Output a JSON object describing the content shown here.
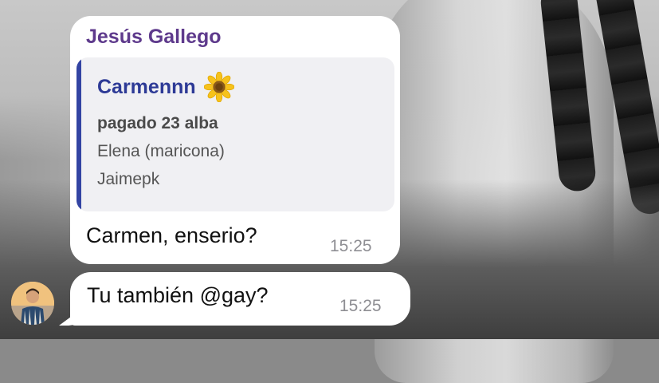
{
  "chat": {
    "messages": [
      {
        "sender": "Jesús Gallego",
        "reply": {
          "author": "Carmennn",
          "author_emoji": "sunflower-icon",
          "lines": [
            "pagado 23 alba",
            "Elena (maricona)",
            "Jaimepk"
          ]
        },
        "text": "Carmen, enserio?",
        "time": "15:25"
      },
      {
        "text": "Tu también @gay?",
        "time": "15:25"
      }
    ]
  },
  "colors": {
    "sender_name": "#5e3a8c",
    "reply_author": "#2d3a96",
    "reply_bar": "#3344a3",
    "bubble": "#ffffff",
    "timestamp": "#8e8e93"
  }
}
